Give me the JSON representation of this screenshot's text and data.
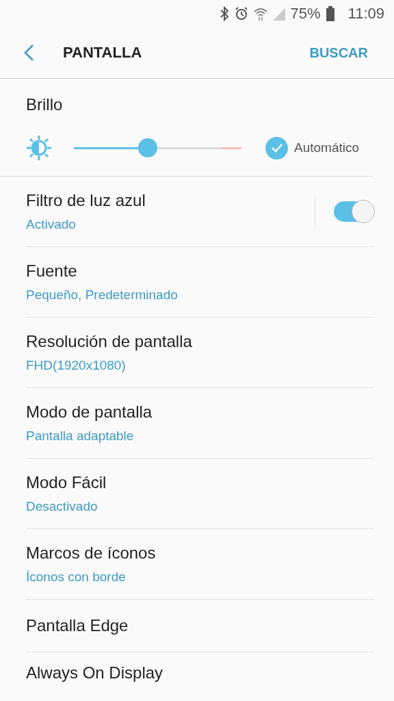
{
  "status_bar": {
    "battery": "75%",
    "time": "11:09"
  },
  "header": {
    "title": "PANTALLA",
    "action": "BUSCAR"
  },
  "brightness": {
    "title": "Brillo",
    "level": 0.44,
    "auto_label": "Automático",
    "auto_checked": true
  },
  "items": [
    {
      "kind": "toggle",
      "title": "Filtro de luz azul",
      "subtitle": "Activado",
      "on": true
    },
    {
      "kind": "link",
      "title": "Fuente",
      "subtitle": "Pequeño, Predeterminado"
    },
    {
      "kind": "link",
      "title": "Resolución de pantalla",
      "subtitle": "FHD(1920x1080)"
    },
    {
      "kind": "link",
      "title": "Modo de pantalla",
      "subtitle": "Pantalla adaptable"
    },
    {
      "kind": "link",
      "title": "Modo Fácil",
      "subtitle": "Desactivado"
    },
    {
      "kind": "link",
      "title": "Marcos de íconos",
      "subtitle": "Íconos con borde"
    },
    {
      "kind": "link",
      "title": "Pantalla Edge"
    },
    {
      "kind": "link",
      "title": "Always On Display"
    }
  ]
}
